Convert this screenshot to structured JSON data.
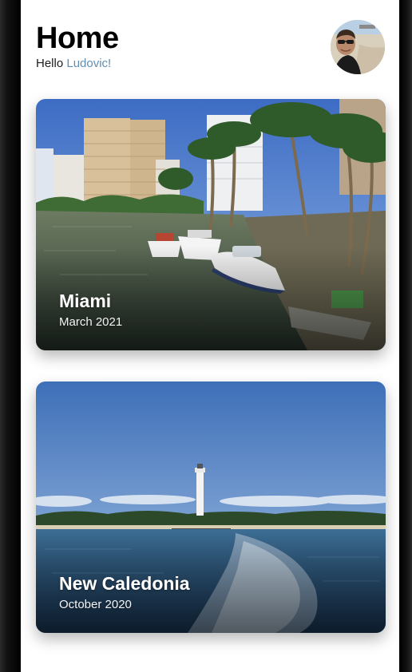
{
  "header": {
    "title": "Home",
    "greeting_prefix": "Hello",
    "user_name": "Ludovic!"
  },
  "avatar": {
    "icon": "user-avatar-photo"
  },
  "trips": [
    {
      "title": "Miami",
      "date": "March 2021",
      "image": "marina-with-boats-and-palm-trees"
    },
    {
      "title": "New Caledonia",
      "date": "October 2020",
      "image": "sea-with-lighthouse-on-island"
    }
  ],
  "colors": {
    "accent_name": "#5d8fb5",
    "background": "#ffffff"
  }
}
